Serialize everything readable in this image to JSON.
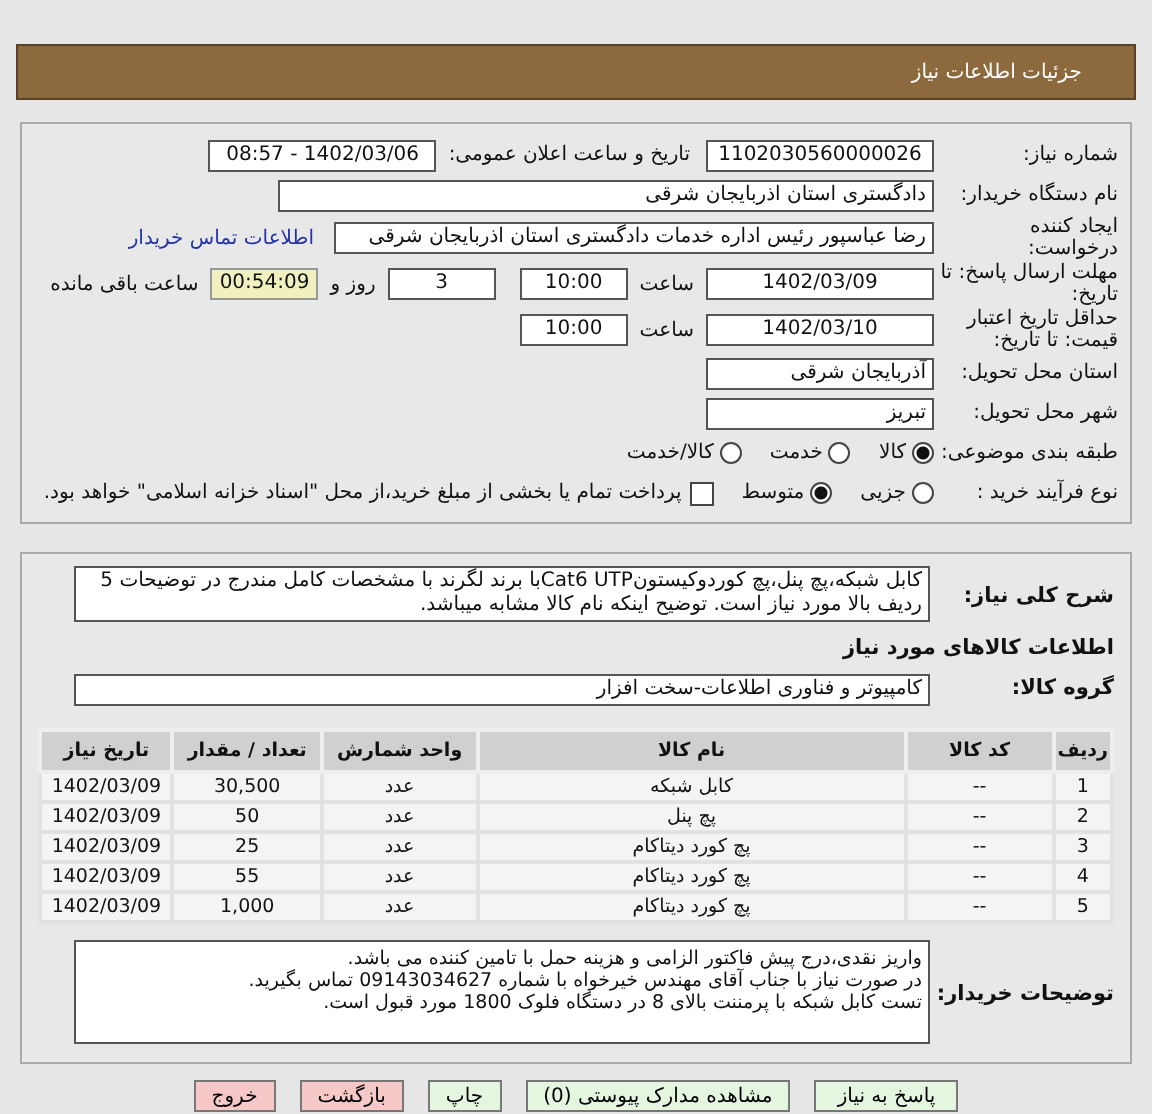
{
  "header": {
    "title": "جزئیات اطلاعات نیاز"
  },
  "need_number": {
    "label": "شماره نیاز:",
    "value": "1102030560000026"
  },
  "announce": {
    "label": "تاریخ و ساعت اعلان عمومی:",
    "value": "1402/03/06 - 08:57"
  },
  "buyer": {
    "label": "نام دستگاه خریدار:",
    "value": "دادگستری استان اذربایجان شرقی"
  },
  "requester": {
    "label": "ایجاد کننده درخواست:",
    "value": "رضا عباسپور رئیس اداره خدمات دادگستری استان اذربایجان شرقی",
    "link": "اطلاعات تماس خریدار"
  },
  "deadline": {
    "label": "مهلت ارسال پاسخ: تا تاریخ:",
    "date": "1402/03/09",
    "time_label": "ساعت",
    "time": "10:00",
    "days": "3",
    "days_label": "روز و",
    "remaining": "00:54:09",
    "remaining_label": "ساعت باقی مانده"
  },
  "validity": {
    "label": "حداقل تاریخ اعتبار قیمت: تا تاریخ:",
    "date": "1402/03/10",
    "time_label": "ساعت",
    "time": "10:00"
  },
  "province": {
    "label": "استان محل تحویل:",
    "value": "آذربایجان شرقی"
  },
  "city": {
    "label": "شهر محل تحویل:",
    "value": "تبریز"
  },
  "category": {
    "label": "طبقه بندی موضوعی:",
    "options": [
      {
        "label": "کالا",
        "selected": true
      },
      {
        "label": "خدمت",
        "selected": false
      },
      {
        "label": "کالا/خدمت",
        "selected": false
      }
    ]
  },
  "process": {
    "label": "نوع فرآیند خرید :",
    "options": [
      {
        "label": "جزیی",
        "selected": false
      },
      {
        "label": "متوسط",
        "selected": true
      }
    ],
    "payment": {
      "label": "پرداخت تمام یا بخشی از مبلغ خرید،از محل \"اسناد خزانه اسلامی\" خواهد بود.",
      "checked": false
    }
  },
  "summary": {
    "label": "شرح کلی نیاز:",
    "value": "کابل شبکه،پچ پنل،پچ کوردوکیستونCat6 UTPبا برند لگرند با مشخصات کامل مندرج در توضیحات  5 ردیف بالا مورد نیاز است. توضیح اینکه نام کالا مشابه میباشد."
  },
  "goods_heading": "اطلاعات کالاهای مورد نیاز",
  "goods_group": {
    "label": "گروه کالا:",
    "value": "کامپیوتر و فناوری اطلاعات-سخت افزار"
  },
  "table": {
    "columns": [
      "ردیف",
      "کد کالا",
      "نام کالا",
      "واحد شمارش",
      "تعداد / مقدار",
      "تاریخ نیاز"
    ],
    "rows": [
      [
        "1",
        "--",
        "کابل شبکه",
        "عدد",
        "30,500",
        "1402/03/09"
      ],
      [
        "2",
        "--",
        "پچ پنل",
        "عدد",
        "50",
        "1402/03/09"
      ],
      [
        "3",
        "--",
        "پچ کورد دیتاکام",
        "عدد",
        "25",
        "1402/03/09"
      ],
      [
        "4",
        "--",
        "پچ کورد دیتاکام",
        "عدد",
        "55",
        "1402/03/09"
      ],
      [
        "5",
        "--",
        "پچ کورد دیتاکام",
        "عدد",
        "1,000",
        "1402/03/09"
      ]
    ]
  },
  "notes": {
    "label": "توضیحات خریدار:",
    "lines": [
      "واریز نقدی،درج پیش فاکتور الزامی و هزینه حمل با تامین کننده می باشد.",
      "در صورت نیاز با جناب آقای مهندس خیرخواه با شماره 09143034627 تماس بگیرید.",
      "تست کابل شبکه با پرمننت بالای 8 در دستگاه فلوک 1800 مورد قبول است."
    ]
  },
  "buttons": [
    {
      "label": "پاسخ به نیاز",
      "kind": "primary"
    },
    {
      "label": "مشاهده مدارک پیوستی (0)",
      "kind": "primary"
    },
    {
      "label": "چاپ",
      "kind": "primary"
    },
    {
      "label": "بازگشت",
      "kind": "danger"
    },
    {
      "label": "خروج",
      "kind": "danger"
    }
  ]
}
